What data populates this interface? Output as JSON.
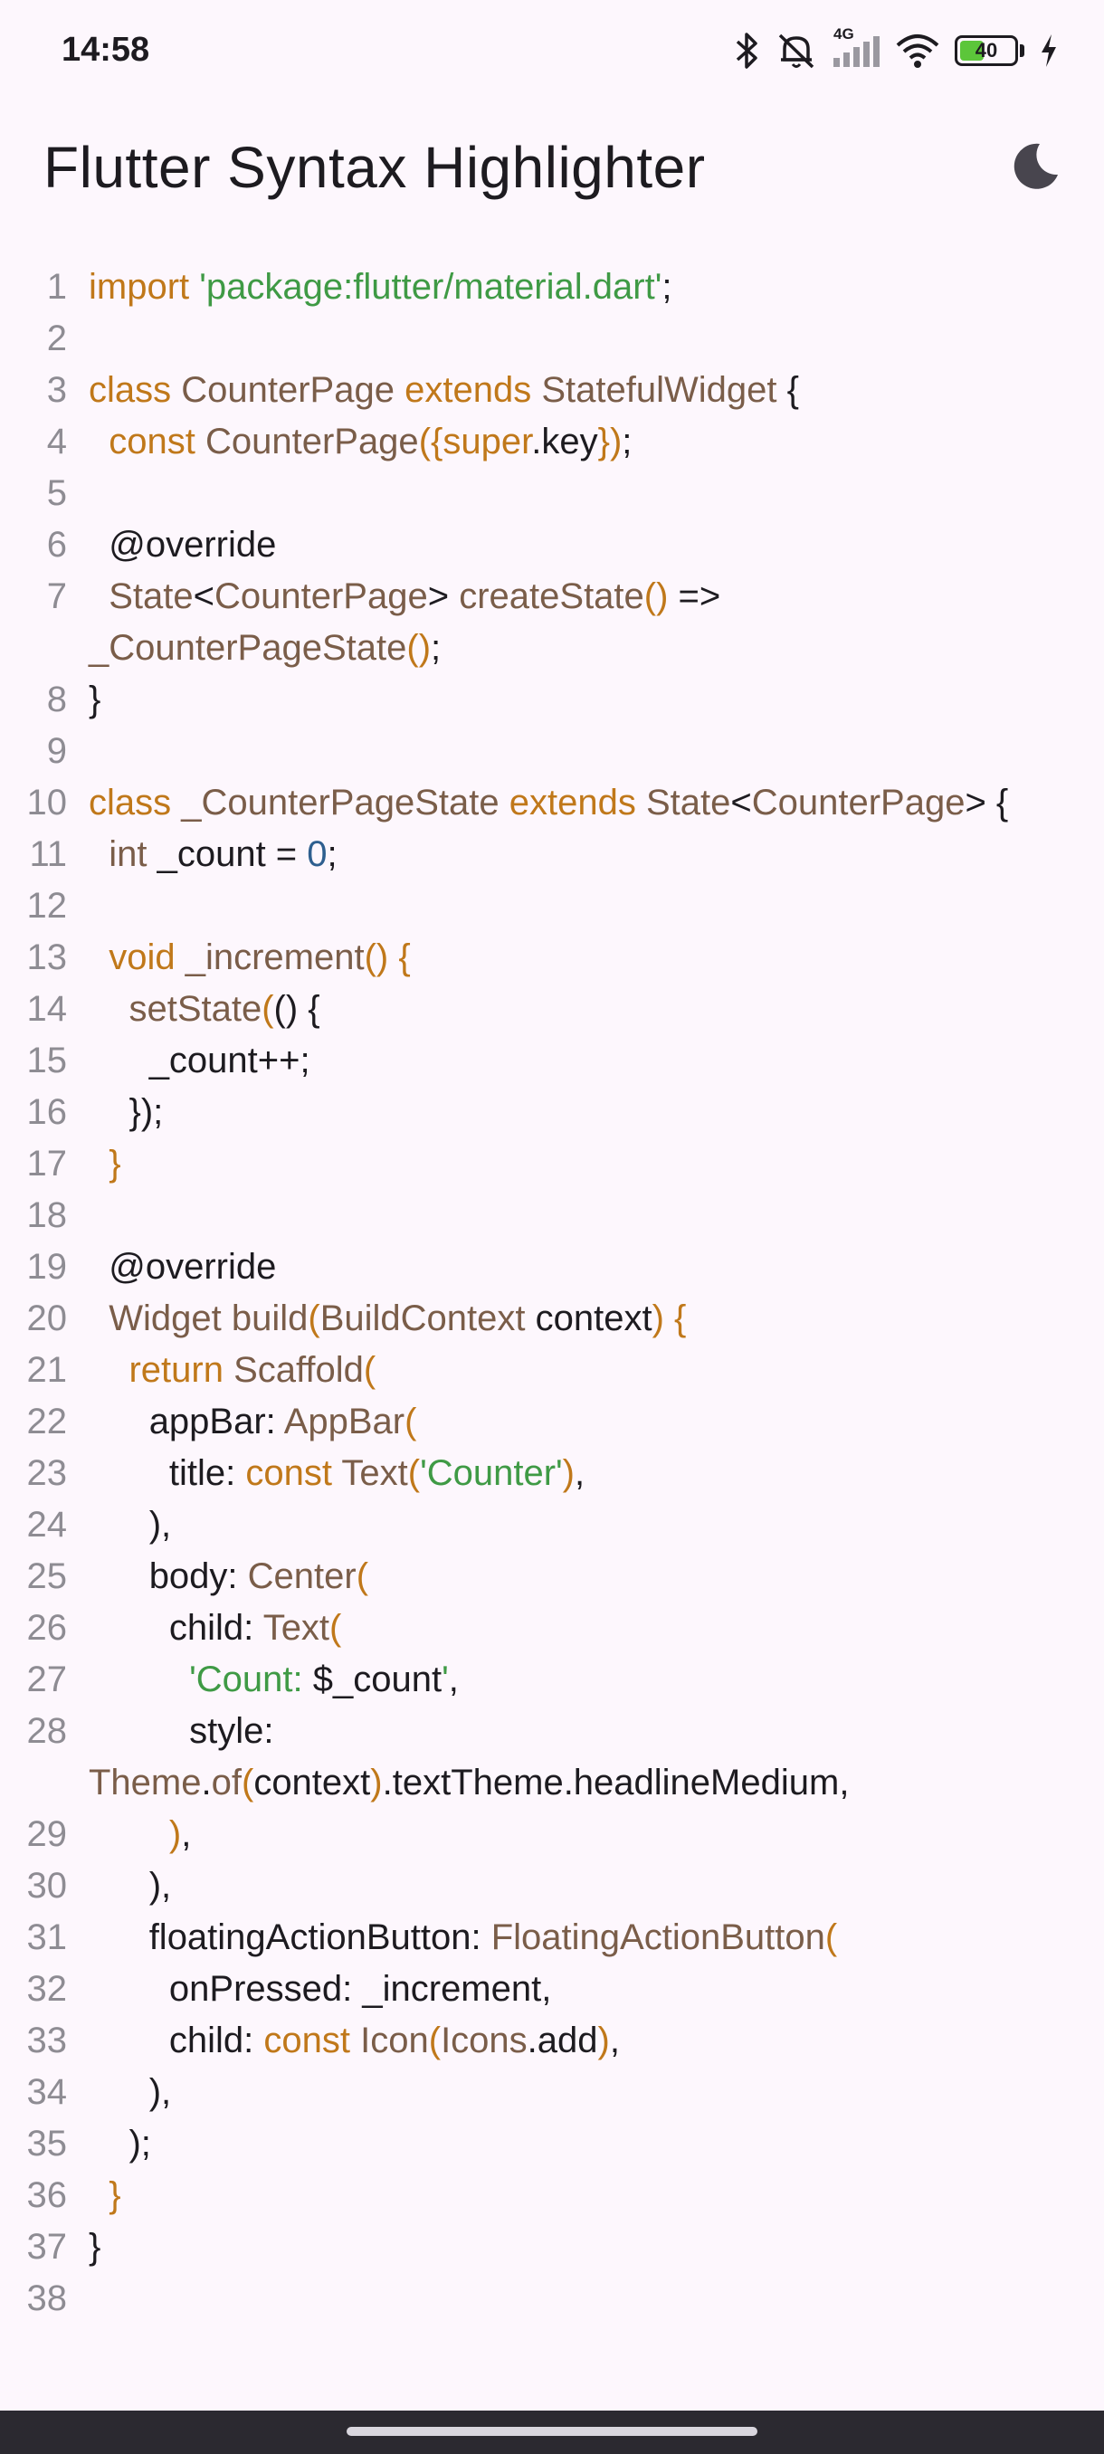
{
  "status_bar": {
    "time": "14:58",
    "battery_level": "40",
    "battery_fraction": 0.4,
    "network_label": "4G",
    "icons": [
      "bluetooth-icon",
      "silent-icon",
      "signal-icon",
      "wifi-icon",
      "battery-icon",
      "charging-icon"
    ]
  },
  "app_bar": {
    "title": "Flutter Syntax Highlighter",
    "theme_toggle_icon": "dark-mode-icon"
  },
  "colors": {
    "keyword": "#c0781a",
    "string": "#3f9a45",
    "type": "#7a5d49",
    "number": "#2e5f8f",
    "plain": "#1d1b20",
    "line_number": "#8e8c93",
    "background": "#fdf7fd"
  },
  "code_lines": [
    {
      "n": "1",
      "tokens": [
        [
          "kw",
          "import "
        ],
        [
          "str",
          "'package:flutter/material.dart'"
        ],
        [
          "p",
          ";"
        ]
      ]
    },
    {
      "n": "2",
      "tokens": []
    },
    {
      "n": "3",
      "tokens": [
        [
          "kw",
          "class "
        ],
        [
          "type",
          "CounterPage "
        ],
        [
          "kw",
          "extends "
        ],
        [
          "type",
          "StatefulWidget"
        ],
        [
          "p",
          " {"
        ]
      ]
    },
    {
      "n": "4",
      "tokens": [
        [
          "p",
          "  "
        ],
        [
          "kw",
          "const "
        ],
        [
          "type",
          "CounterPage"
        ],
        [
          "kw",
          "({"
        ],
        [
          "kw",
          "super"
        ],
        [
          "p",
          ".key"
        ],
        [
          "kw",
          "})"
        ],
        [
          "p",
          ";"
        ]
      ]
    },
    {
      "n": "5",
      "tokens": []
    },
    {
      "n": "6",
      "tokens": [
        [
          "p",
          "  @override"
        ]
      ]
    },
    {
      "n": "7",
      "tokens": [
        [
          "p",
          "  "
        ],
        [
          "type",
          "State"
        ],
        [
          "p",
          "<"
        ],
        [
          "type",
          "CounterPage"
        ],
        [
          "p",
          "> "
        ],
        [
          "type",
          "createState"
        ],
        [
          "kw",
          "()"
        ],
        [
          "p",
          " => "
        ]
      ],
      "wrap": [
        [
          "type",
          "_CounterPageState"
        ],
        [
          "kw",
          "()"
        ],
        [
          "p",
          ";"
        ]
      ]
    },
    {
      "n": "8",
      "tokens": [
        [
          "p",
          "}"
        ]
      ]
    },
    {
      "n": "9",
      "tokens": []
    },
    {
      "n": "10",
      "tokens": [
        [
          "kw",
          "class "
        ],
        [
          "type",
          "_CounterPageState "
        ],
        [
          "kw",
          "extends "
        ],
        [
          "type",
          "State"
        ],
        [
          "p",
          "<"
        ],
        [
          "type",
          "CounterPage"
        ],
        [
          "p",
          "> {"
        ]
      ]
    },
    {
      "n": "11",
      "tokens": [
        [
          "p",
          "  "
        ],
        [
          "type",
          "int "
        ],
        [
          "p",
          "_count = "
        ],
        [
          "num",
          "0"
        ],
        [
          "p",
          ";"
        ]
      ]
    },
    {
      "n": "12",
      "tokens": []
    },
    {
      "n": "13",
      "tokens": [
        [
          "p",
          "  "
        ],
        [
          "kw",
          "void "
        ],
        [
          "type",
          "_increment"
        ],
        [
          "kw",
          "() {"
        ]
      ]
    },
    {
      "n": "14",
      "tokens": [
        [
          "p",
          "    "
        ],
        [
          "type",
          "setState"
        ],
        [
          "kw",
          "("
        ],
        [
          "p",
          "() {"
        ]
      ]
    },
    {
      "n": "15",
      "tokens": [
        [
          "p",
          "      _count++;"
        ]
      ]
    },
    {
      "n": "16",
      "tokens": [
        [
          "p",
          "    });"
        ]
      ]
    },
    {
      "n": "17",
      "tokens": [
        [
          "p",
          "  "
        ],
        [
          "kw",
          "}"
        ]
      ]
    },
    {
      "n": "18",
      "tokens": []
    },
    {
      "n": "19",
      "tokens": [
        [
          "p",
          "  @override"
        ]
      ]
    },
    {
      "n": "20",
      "tokens": [
        [
          "p",
          "  "
        ],
        [
          "type",
          "Widget build"
        ],
        [
          "kw",
          "("
        ],
        [
          "type",
          "BuildContext "
        ],
        [
          "p",
          "context"
        ],
        [
          "kw",
          ") {"
        ]
      ]
    },
    {
      "n": "21",
      "tokens": [
        [
          "p",
          "    "
        ],
        [
          "kw",
          "return "
        ],
        [
          "type",
          "Scaffold"
        ],
        [
          "kw",
          "("
        ]
      ]
    },
    {
      "n": "22",
      "tokens": [
        [
          "p",
          "      appBar: "
        ],
        [
          "type",
          "AppBar"
        ],
        [
          "kw",
          "("
        ]
      ]
    },
    {
      "n": "23",
      "tokens": [
        [
          "p",
          "        title: "
        ],
        [
          "kw",
          "const "
        ],
        [
          "type",
          "Text"
        ],
        [
          "kw",
          "("
        ],
        [
          "str",
          "'Counter'"
        ],
        [
          "kw",
          ")"
        ],
        [
          "p",
          ","
        ]
      ]
    },
    {
      "n": "24",
      "tokens": [
        [
          "p",
          "      ),"
        ]
      ]
    },
    {
      "n": "25",
      "tokens": [
        [
          "p",
          "      body: "
        ],
        [
          "type",
          "Center"
        ],
        [
          "kw",
          "("
        ]
      ]
    },
    {
      "n": "26",
      "tokens": [
        [
          "p",
          "        child: "
        ],
        [
          "type",
          "Text"
        ],
        [
          "kw",
          "("
        ]
      ]
    },
    {
      "n": "27",
      "tokens": [
        [
          "p",
          "          "
        ],
        [
          "str",
          "'Count: "
        ],
        [
          "p",
          "$_count"
        ],
        [
          "str",
          "'"
        ],
        [
          "p",
          ","
        ]
      ]
    },
    {
      "n": "28",
      "tokens": [
        [
          "p",
          "          style: "
        ]
      ],
      "wrap": [
        [
          "type",
          "Theme"
        ],
        [
          "p",
          "."
        ],
        [
          "type",
          "of"
        ],
        [
          "kw",
          "("
        ],
        [
          "p",
          "context"
        ],
        [
          "kw",
          ")"
        ],
        [
          "p",
          ".textTheme.headlineMedium,"
        ]
      ]
    },
    {
      "n": "29",
      "tokens": [
        [
          "p",
          "        "
        ],
        [
          "kw",
          ")"
        ],
        [
          "p",
          ","
        ]
      ]
    },
    {
      "n": "30",
      "tokens": [
        [
          "p",
          "      ),"
        ]
      ]
    },
    {
      "n": "31",
      "tokens": [
        [
          "p",
          "      floatingActionButton: "
        ],
        [
          "type",
          "FloatingActionButton"
        ],
        [
          "kw",
          "("
        ]
      ]
    },
    {
      "n": "32",
      "tokens": [
        [
          "p",
          "        onPressed: _increment,"
        ]
      ]
    },
    {
      "n": "33",
      "tokens": [
        [
          "p",
          "        child: "
        ],
        [
          "kw",
          "const "
        ],
        [
          "type",
          "Icon"
        ],
        [
          "kw",
          "("
        ],
        [
          "type",
          "Icons"
        ],
        [
          "p",
          ".add"
        ],
        [
          "kw",
          ")"
        ],
        [
          "p",
          ","
        ]
      ]
    },
    {
      "n": "34",
      "tokens": [
        [
          "p",
          "      ),"
        ]
      ]
    },
    {
      "n": "35",
      "tokens": [
        [
          "p",
          "    );"
        ]
      ]
    },
    {
      "n": "36",
      "tokens": [
        [
          "p",
          "  "
        ],
        [
          "kw",
          "}"
        ]
      ]
    },
    {
      "n": "37",
      "tokens": [
        [
          "p",
          "}"
        ]
      ]
    },
    {
      "n": "38",
      "tokens": []
    }
  ]
}
